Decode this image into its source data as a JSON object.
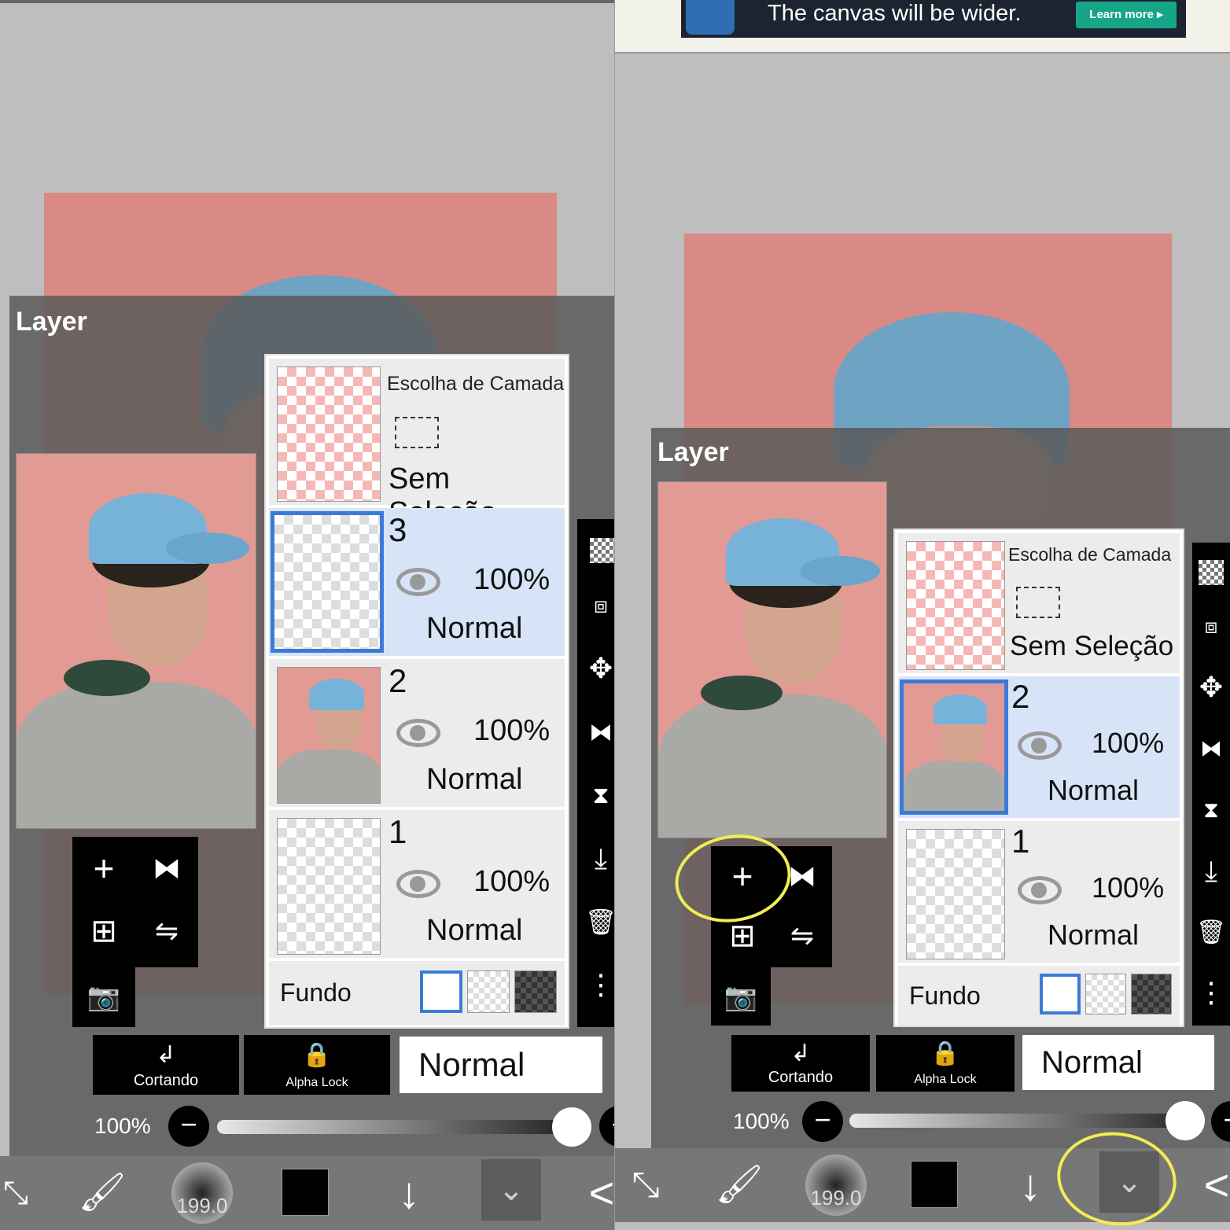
{
  "ad": {
    "text": "The canvas will be wider.",
    "button": "Learn more ▸"
  },
  "panel": {
    "title": "Layer",
    "selection_layer": {
      "title": "Escolha de Camada",
      "status": "Sem Seleção"
    },
    "fundo_label": "Fundo",
    "cortando_label": "Cortando",
    "alpha_lock_label": "Alpha Lock",
    "blend_mode": "Normal",
    "opacity": "100%",
    "minus": "−",
    "plus": "+"
  },
  "left_layers": [
    {
      "number": "3",
      "opacity": "100%",
      "mode": "Normal",
      "selected": true
    },
    {
      "number": "2",
      "opacity": "100%",
      "mode": "Normal",
      "selected": false
    },
    {
      "number": "1",
      "opacity": "100%",
      "mode": "Normal",
      "selected": false
    }
  ],
  "right_layers": [
    {
      "number": "2",
      "opacity": "100%",
      "mode": "Normal",
      "selected": true
    },
    {
      "number": "1",
      "opacity": "100%",
      "mode": "Normal",
      "selected": false
    }
  ],
  "tools": {
    "add_layer_icon": "+",
    "flip_icon": "⧓",
    "add_copy_icon": "⊞",
    "merge_icon": "⇋",
    "camera_icon": "📷"
  },
  "sidebar_icons": [
    "transparent-icon",
    "select-layer-icon",
    "move-icon",
    "flip-icon",
    "merge-down-icon",
    "download-icon",
    "trash-icon",
    "more-icon"
  ],
  "bottom_bar": {
    "brush_size": "199.0",
    "down_arrow": "↓",
    "layers_chevron": "⌄",
    "back_arrow": "<"
  },
  "colors": {
    "selection_blue": "#3b7ad8",
    "canvas_pink": "#d98a85",
    "highlight_yellow": "#f3ec54"
  }
}
